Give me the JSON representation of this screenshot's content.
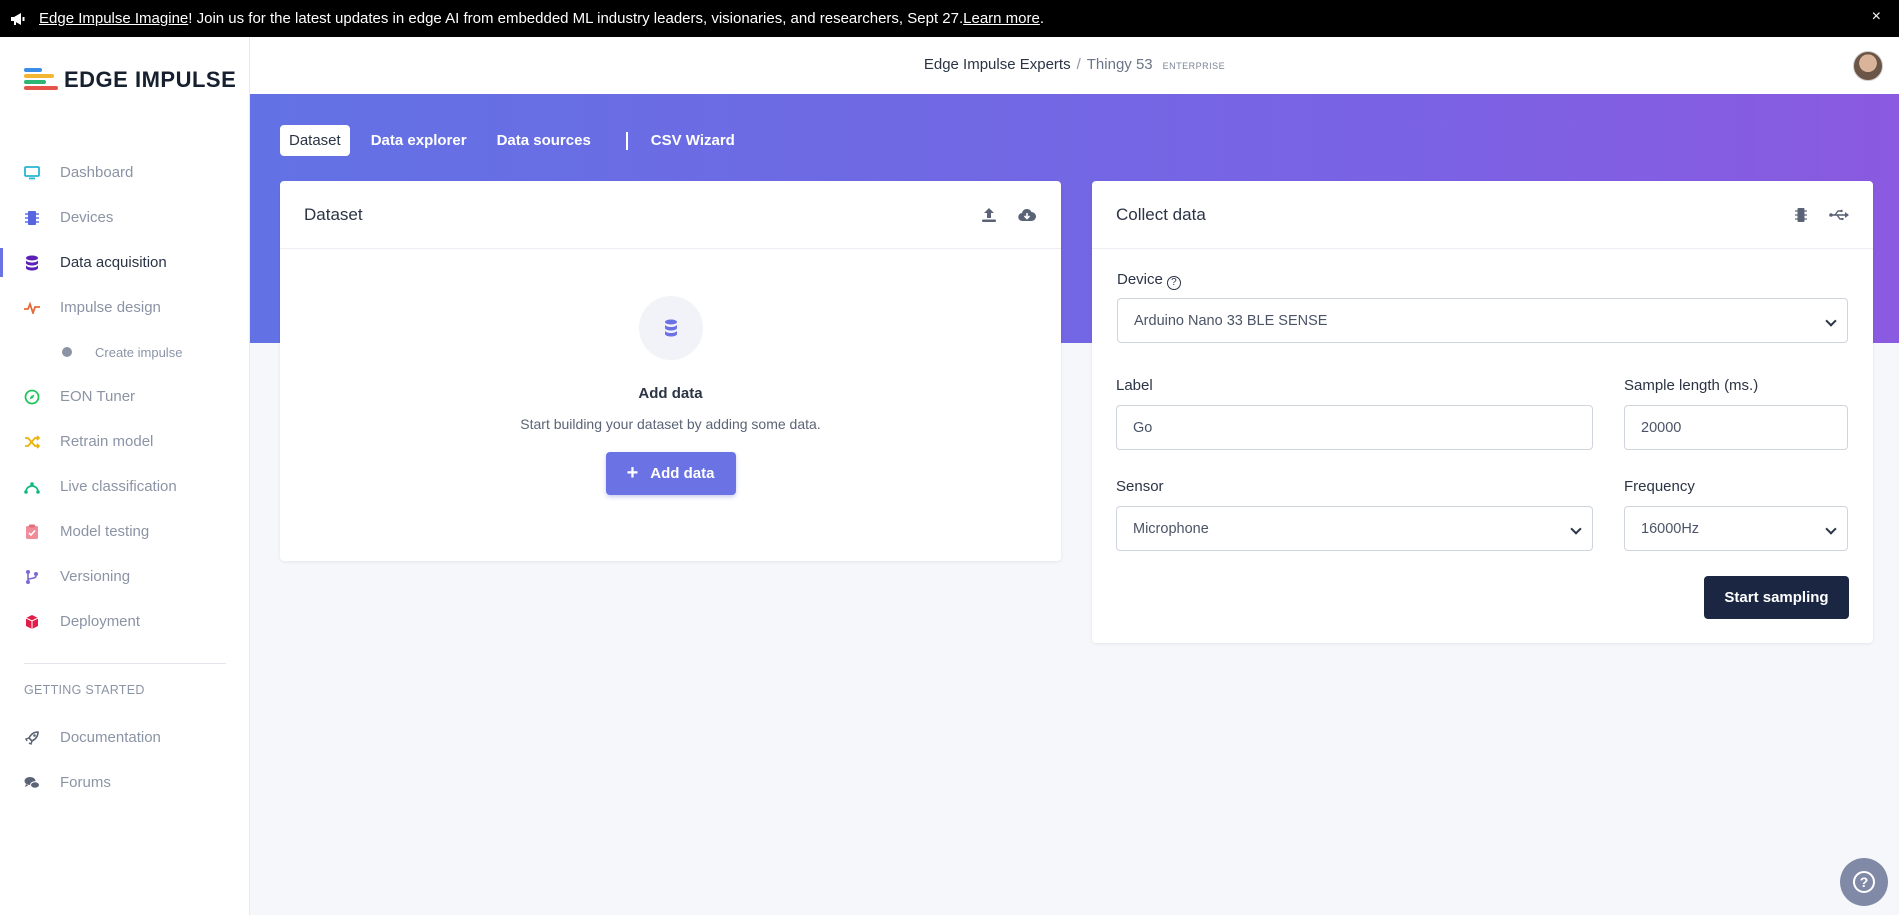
{
  "announcement": {
    "link": "Edge Impulse Imagine",
    "text": "! Join us for the latest updates in edge AI from embedded ML industry leaders, visionaries, and researchers, Sept 27. ",
    "learn_more": "Learn more",
    "end": ".",
    "close": "×"
  },
  "logo": {
    "text": "EDGE IMPULSE"
  },
  "sidebar": {
    "items": [
      {
        "label": "Dashboard",
        "icon": "monitor-icon",
        "color": "#27b6d3"
      },
      {
        "label": "Devices",
        "icon": "chip-icon",
        "color": "#5865e0"
      },
      {
        "label": "Data acquisition",
        "icon": "database-icon",
        "color": "#5b21b6"
      },
      {
        "label": "Impulse design",
        "icon": "pulse-icon",
        "color": "#e5693a"
      },
      {
        "label": "Create impulse",
        "icon": "dot-icon"
      },
      {
        "label": "EON Tuner",
        "icon": "compass-icon",
        "color": "#22c55e"
      },
      {
        "label": "Retrain model",
        "icon": "shuffle-icon",
        "color": "#eab308"
      },
      {
        "label": "Live classification",
        "icon": "bezier-icon",
        "color": "#10b981"
      },
      {
        "label": "Model testing",
        "icon": "clipboard-check-icon",
        "color": "#f08b9a"
      },
      {
        "label": "Versioning",
        "icon": "git-branch-icon",
        "color": "#7c68d6"
      },
      {
        "label": "Deployment",
        "icon": "cube-icon",
        "color": "#e11d48"
      }
    ],
    "section_label": "GETTING STARTED",
    "footer_items": [
      {
        "label": "Documentation",
        "icon": "rocket-icon"
      },
      {
        "label": "Forums",
        "icon": "comments-icon"
      }
    ]
  },
  "topbar": {
    "org": "Edge Impulse Experts",
    "separator": "/",
    "project": "Thingy 53",
    "badge": "ENTERPRISE"
  },
  "tabs": [
    {
      "label": "Dataset",
      "active": true
    },
    {
      "label": "Data explorer"
    },
    {
      "label": "Data sources"
    },
    {
      "label": "CSV Wizard"
    }
  ],
  "dataset_card": {
    "title": "Dataset",
    "empty_title": "Add data",
    "empty_sub": "Start building your dataset by adding some data.",
    "button": "Add data"
  },
  "collect_card": {
    "title": "Collect data",
    "device_label": "Device",
    "device_value": "Arduino Nano 33 BLE SENSE",
    "label_label": "Label",
    "label_value": "Go",
    "sample_length_label": "Sample length (ms.)",
    "sample_length_value": "20000",
    "sensor_label": "Sensor",
    "sensor_value": "Microphone",
    "frequency_label": "Frequency",
    "frequency_value": "16000Hz",
    "button": "Start sampling"
  },
  "colors": {
    "accent": "#6a72e4",
    "hero_start": "#6272e4",
    "hero_end": "#8a5ae0",
    "dark_button": "#1a2642"
  }
}
